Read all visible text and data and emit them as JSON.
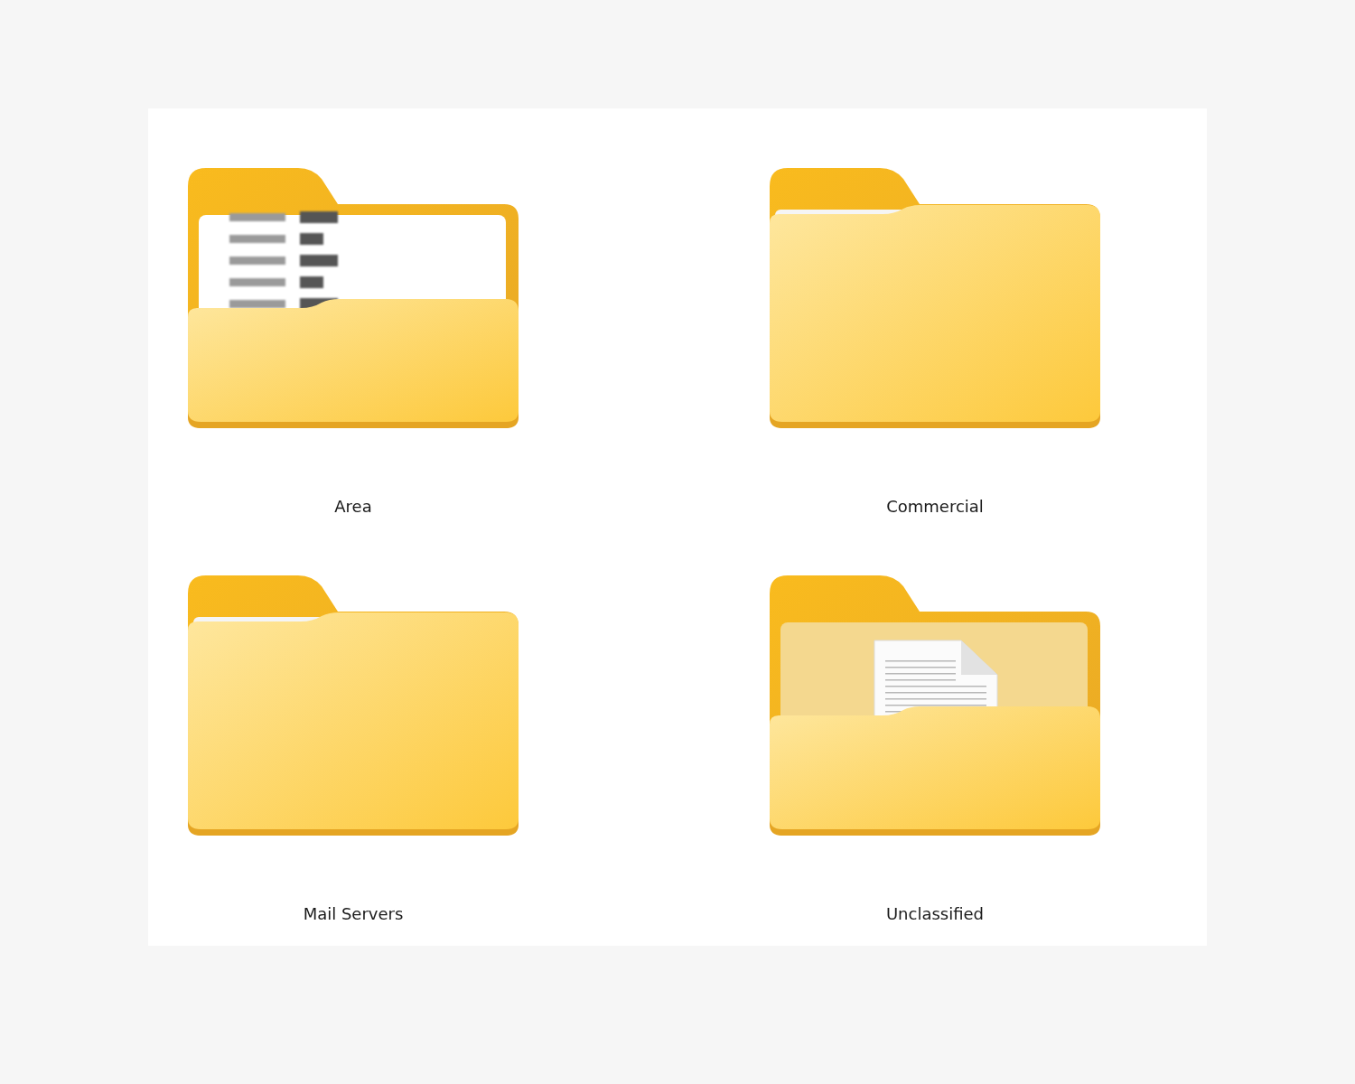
{
  "folders": [
    {
      "name": "Area",
      "kind": "preview"
    },
    {
      "name": "Commercial",
      "kind": "empty"
    },
    {
      "name": "Mail Servers",
      "kind": "empty"
    },
    {
      "name": "Unclassified",
      "kind": "document"
    }
  ]
}
